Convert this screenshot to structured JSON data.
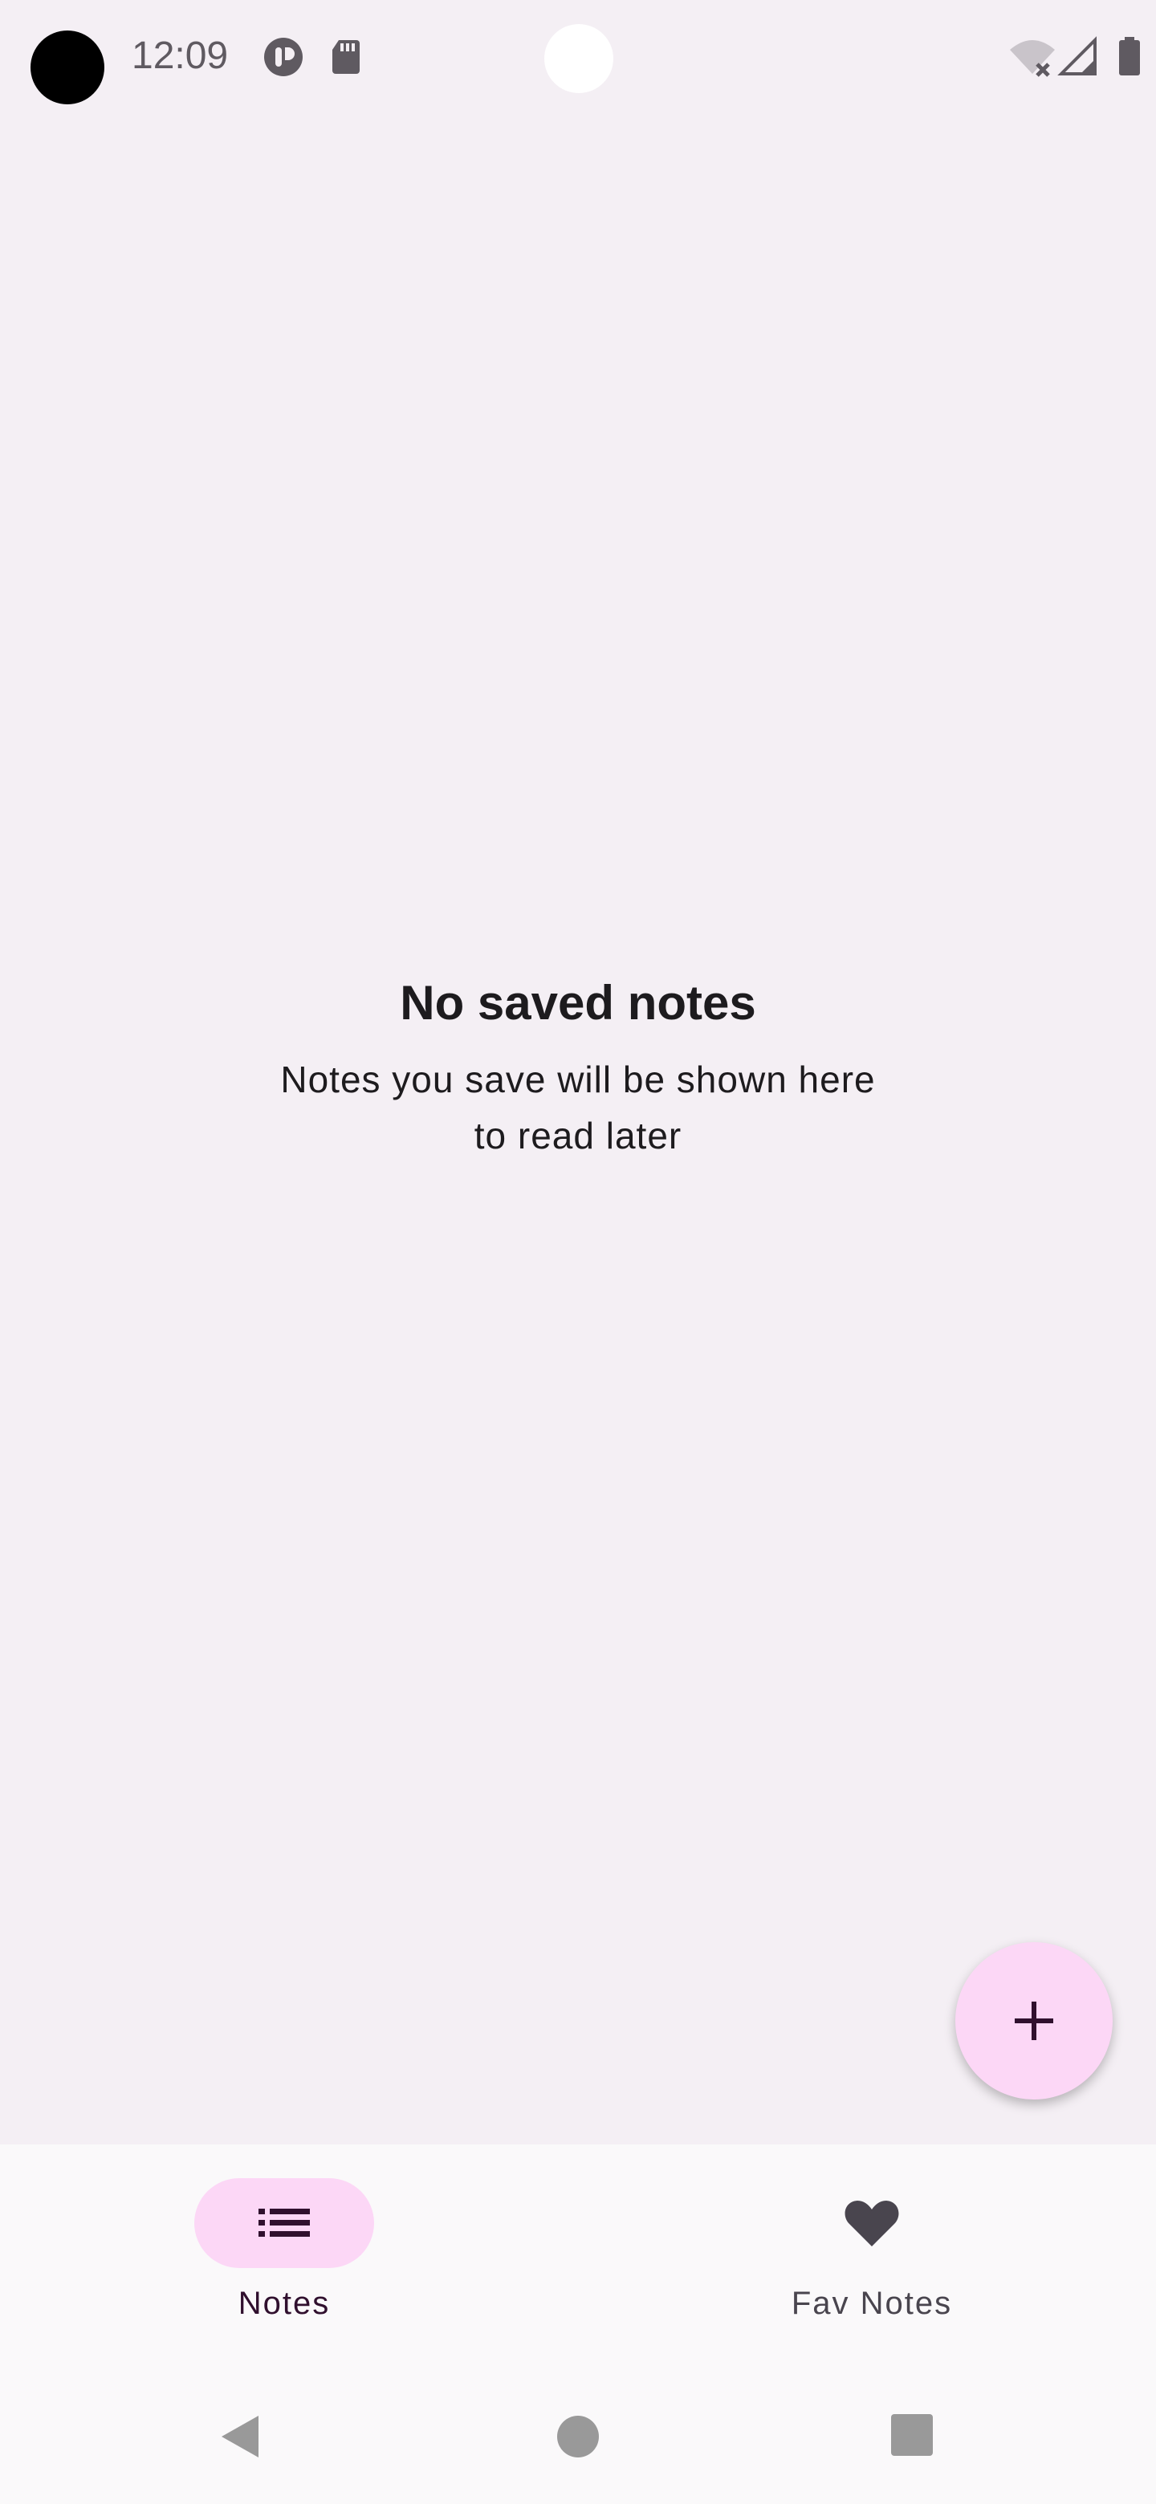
{
  "status_bar": {
    "time": "12:09",
    "left_icons": [
      "app-notification-icon",
      "sd-card-icon"
    ],
    "right_icons": [
      "wifi-off-icon",
      "cell-signal-icon",
      "battery-icon"
    ]
  },
  "empty_state": {
    "title": "No saved notes",
    "body_line1": "Notes you save will be shown here",
    "body_line2": "to read later"
  },
  "fab": {
    "icon": "add-icon"
  },
  "bottom_nav": {
    "items": [
      {
        "label": "Notes",
        "icon": "list-icon",
        "selected": true
      },
      {
        "label": "Fav Notes",
        "icon": "heart-icon",
        "selected": false
      }
    ]
  },
  "system_nav": {
    "buttons": [
      "back-icon",
      "home-icon",
      "recents-icon"
    ]
  },
  "colors": {
    "background": "#f4eff4",
    "accent_container": "#fcd7f6",
    "on_accent": "#30102e",
    "nav_background": "#faf9fa",
    "text_primary": "#1d1b1e",
    "text_secondary": "#49454e"
  }
}
